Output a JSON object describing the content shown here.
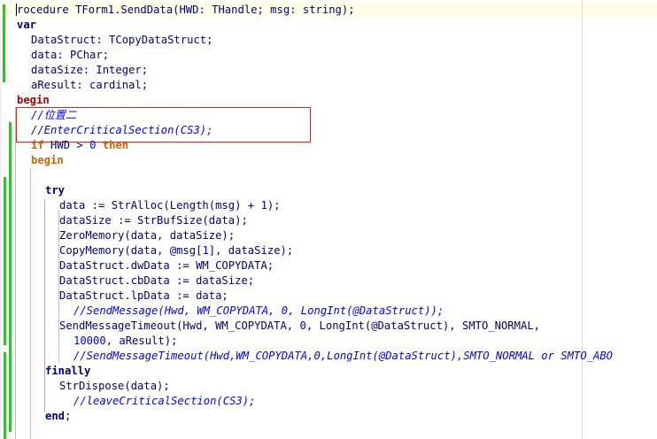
{
  "editor": {
    "colors": {
      "background": "#ffffff",
      "identifier": "#000080",
      "keyword_begin": "#b00000",
      "numbers": "#0000ff",
      "comments": "#0000ff",
      "change_marker": "#22cc22",
      "selection_box": "#e02020"
    },
    "lines": [
      {
        "parts": [
          {
            "t": "p",
            "text": "rocedure "
          },
          {
            "t": "p",
            "text": "TForm1.SendData(HWD: THandle; msg: string);"
          }
        ]
      },
      {
        "parts": [
          {
            "t": "kw",
            "text": "var"
          }
        ]
      },
      {
        "parts": [
          {
            "t": "p",
            "text": "DataStruct: TCopyDataStruct;"
          }
        ]
      },
      {
        "parts": [
          {
            "t": "p",
            "text": "data: PChar;"
          }
        ]
      },
      {
        "parts": [
          {
            "t": "p",
            "text": "dataSize: Integer;"
          }
        ]
      },
      {
        "parts": [
          {
            "t": "p",
            "text": "aResult: cardinal;"
          }
        ]
      },
      {
        "parts": [
          {
            "t": "kwr",
            "text": "begin"
          }
        ]
      },
      {
        "parts": [
          {
            "t": "cmt",
            "text": "//位置二"
          }
        ]
      },
      {
        "parts": [
          {
            "t": "cmt",
            "text": "//EnterCriticalSection(CS3);"
          }
        ]
      },
      {
        "parts": [
          {
            "t": "ob",
            "text": "if"
          },
          {
            "t": "p",
            "text": " HWD > "
          },
          {
            "t": "num",
            "text": "0"
          },
          {
            "t": "p",
            "text": " "
          },
          {
            "t": "ob",
            "text": "then"
          }
        ]
      },
      {
        "parts": [
          {
            "t": "ob",
            "text": "begin"
          }
        ]
      },
      {
        "parts": []
      },
      {
        "parts": [
          {
            "t": "kw",
            "text": "try"
          }
        ]
      },
      {
        "parts": [
          {
            "t": "p",
            "text": "data := StrAlloc(Length(msg) + "
          },
          {
            "t": "num",
            "text": "1"
          },
          {
            "t": "p",
            "text": ");"
          }
        ]
      },
      {
        "parts": [
          {
            "t": "p",
            "text": "dataSize := StrBufSize(data);"
          }
        ]
      },
      {
        "parts": [
          {
            "t": "p",
            "text": "ZeroMemory(data, dataSize);"
          }
        ]
      },
      {
        "parts": [
          {
            "t": "p",
            "text": "CopyMemory(data, @msg["
          },
          {
            "t": "num",
            "text": "1"
          },
          {
            "t": "p",
            "text": "], dataSize);"
          }
        ]
      },
      {
        "parts": [
          {
            "t": "p",
            "text": "DataStruct.dwData := WM_COPYDATA;"
          }
        ]
      },
      {
        "parts": [
          {
            "t": "p",
            "text": "DataStruct.cbData := dataSize;"
          }
        ]
      },
      {
        "parts": [
          {
            "t": "p",
            "text": "DataStruct.lpData := data;"
          }
        ]
      },
      {
        "parts": [
          {
            "t": "cmt",
            "text": "//SendMessage(Hwd, WM_COPYDATA, 0, LongInt(@DataStruct));"
          }
        ]
      },
      {
        "parts": [
          {
            "t": "p",
            "text": "SendMessageTimeout(Hwd, WM_COPYDATA, "
          },
          {
            "t": "num",
            "text": "0"
          },
          {
            "t": "p",
            "text": ", LongInt(@DataStruct), SMTO_NORMAL,"
          }
        ]
      },
      {
        "parts": [
          {
            "t": "num",
            "text": "10000"
          },
          {
            "t": "p",
            "text": ", aResult);"
          }
        ]
      },
      {
        "parts": [
          {
            "t": "cmt",
            "text": "//SendMessageTimeout(Hwd,WM_COPYDATA,0,LongInt(@DataStruct),SMTO_NORMAL or SMTO_ABO"
          }
        ]
      },
      {
        "parts": [
          {
            "t": "kw",
            "text": "finally"
          }
        ]
      },
      {
        "parts": [
          {
            "t": "p",
            "text": "StrDispose(data);"
          }
        ]
      },
      {
        "parts": [
          {
            "t": "cmt",
            "text": "//leaveCriticalSection(CS3);"
          }
        ]
      },
      {
        "parts": [
          {
            "t": "kw",
            "text": "end"
          },
          {
            "t": "p",
            "text": ";"
          }
        ]
      }
    ]
  }
}
